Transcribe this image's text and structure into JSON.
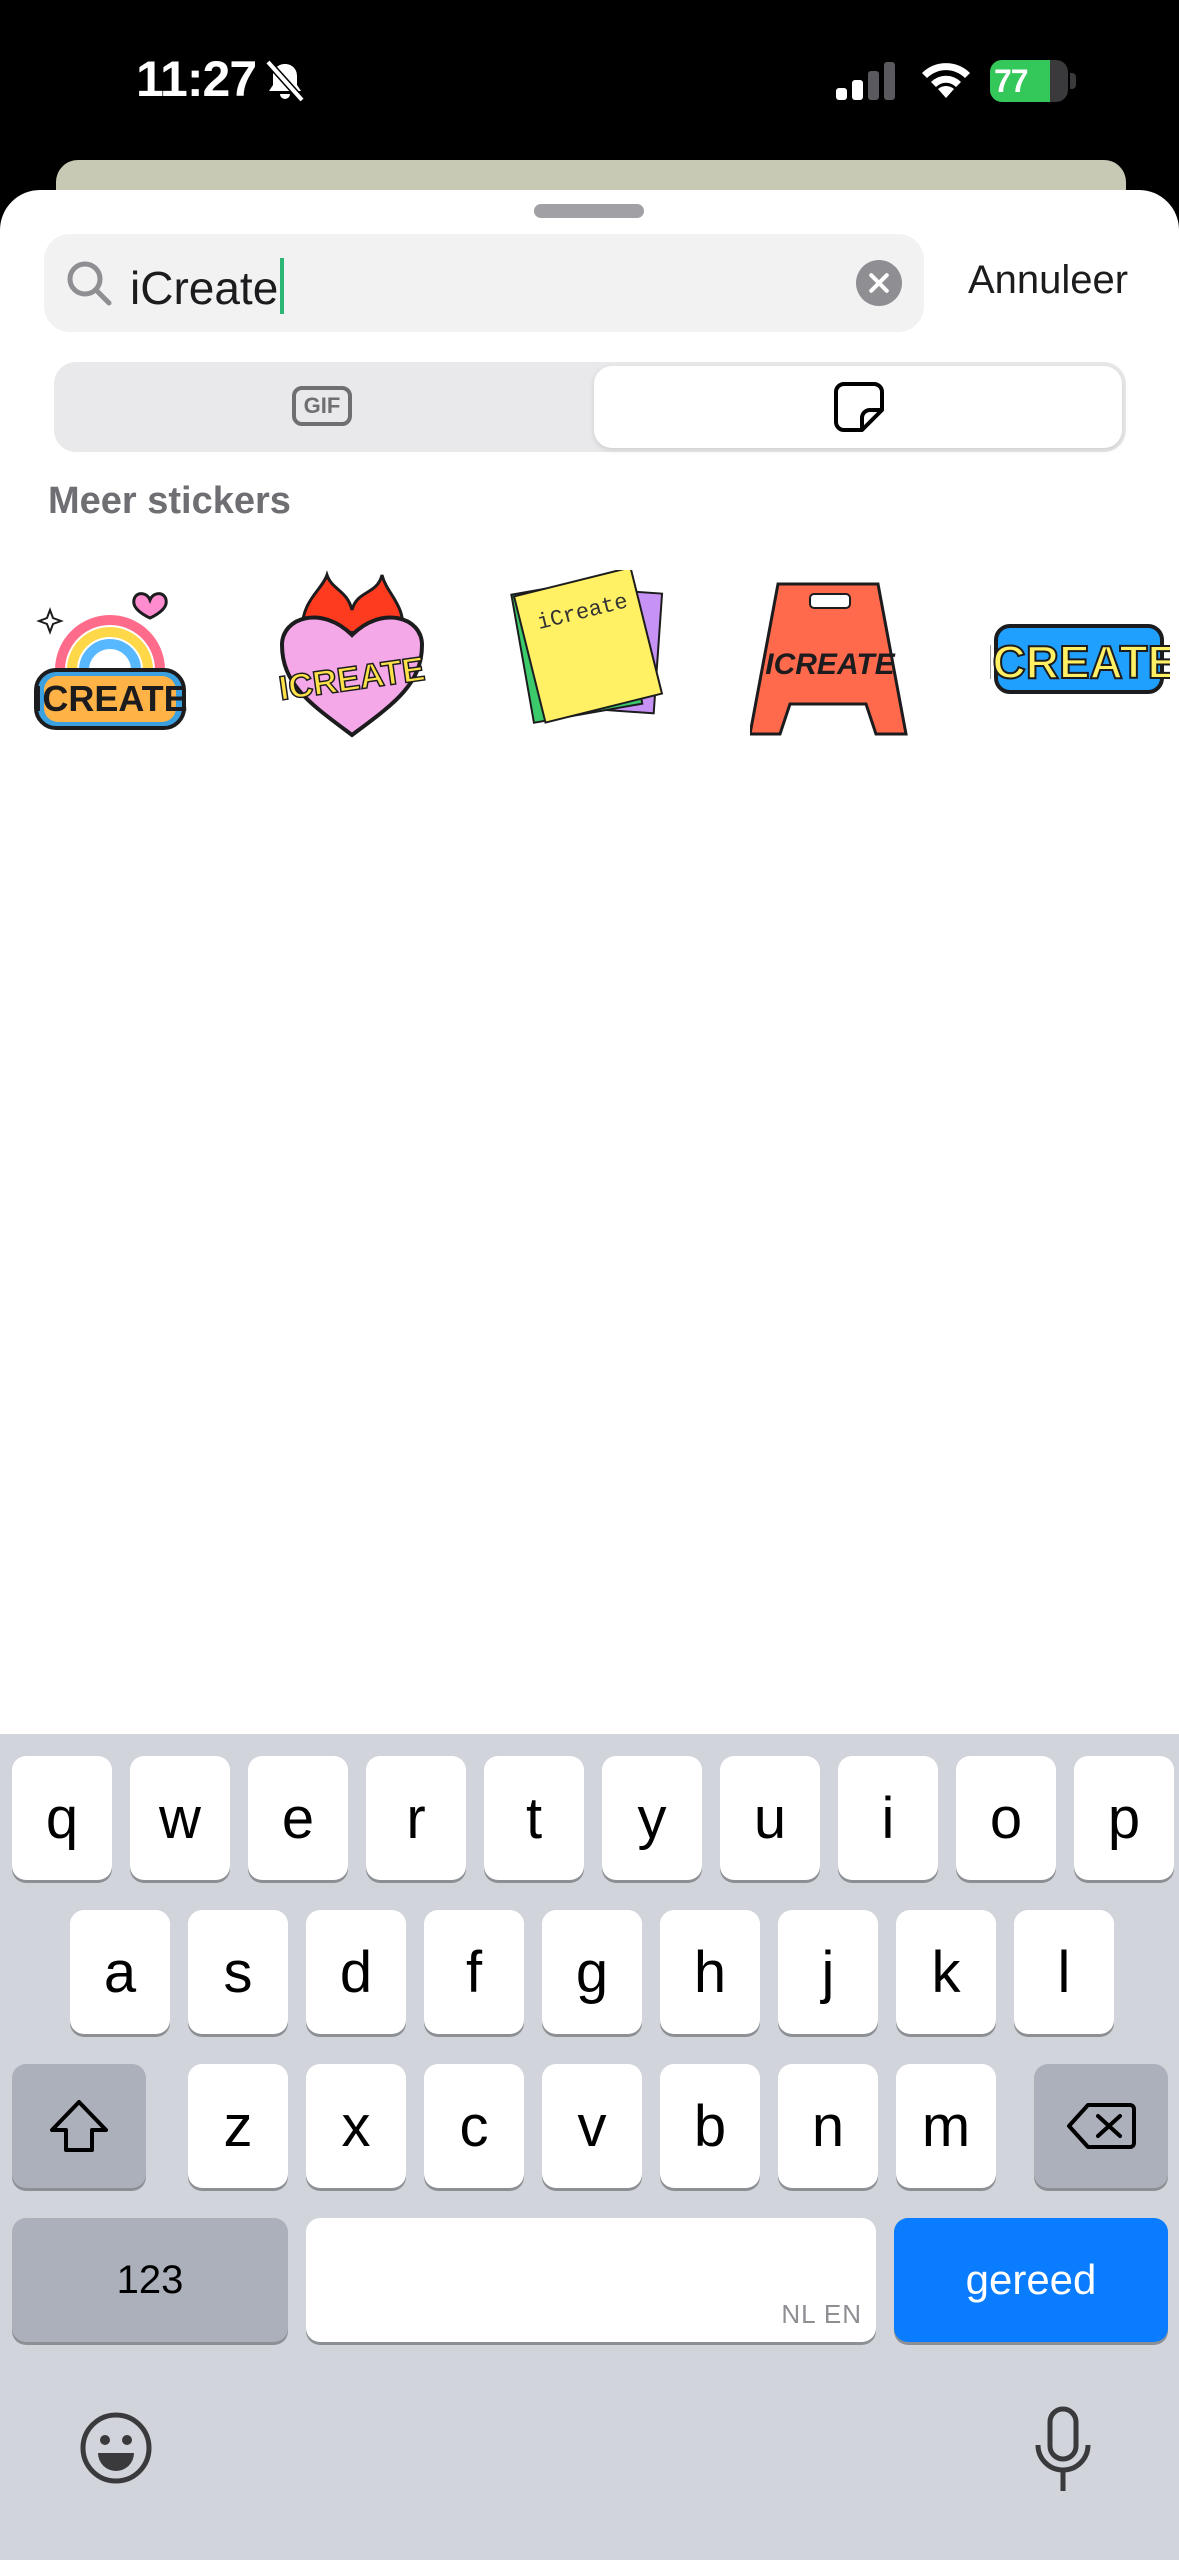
{
  "status": {
    "time": "11:27",
    "battery": "77",
    "battery_level": 0.77,
    "battery_color": "#34c759"
  },
  "search": {
    "query": "iCreate",
    "cancel_label": "Annuleer"
  },
  "tabs": {
    "gif_label": "GIF",
    "selected": "stickers"
  },
  "section": {
    "title": "Meer stickers"
  },
  "stickers": [
    {
      "icon": "rainbow-icreate-sticker",
      "text": "ICREATE"
    },
    {
      "icon": "flaming-heart-icreate-sticker",
      "text": "ICREATE"
    },
    {
      "icon": "sticky-notes-icreate-sticker",
      "text": "iCreate"
    },
    {
      "icon": "wet-floor-sign-icreate-sticker",
      "text": "ICREATE"
    },
    {
      "icon": "bold-icreate-text-sticker",
      "text": "ICREATE"
    }
  ],
  "keyboard": {
    "row1": [
      "q",
      "w",
      "e",
      "r",
      "t",
      "y",
      "u",
      "i",
      "o",
      "p"
    ],
    "row2": [
      "a",
      "s",
      "d",
      "f",
      "g",
      "h",
      "j",
      "k",
      "l"
    ],
    "row3": [
      "z",
      "x",
      "c",
      "v",
      "b",
      "n",
      "m"
    ],
    "numbers_label": "123",
    "space_lang": "NL EN",
    "return_label": "gereed",
    "return_color": "#0a7cff"
  }
}
